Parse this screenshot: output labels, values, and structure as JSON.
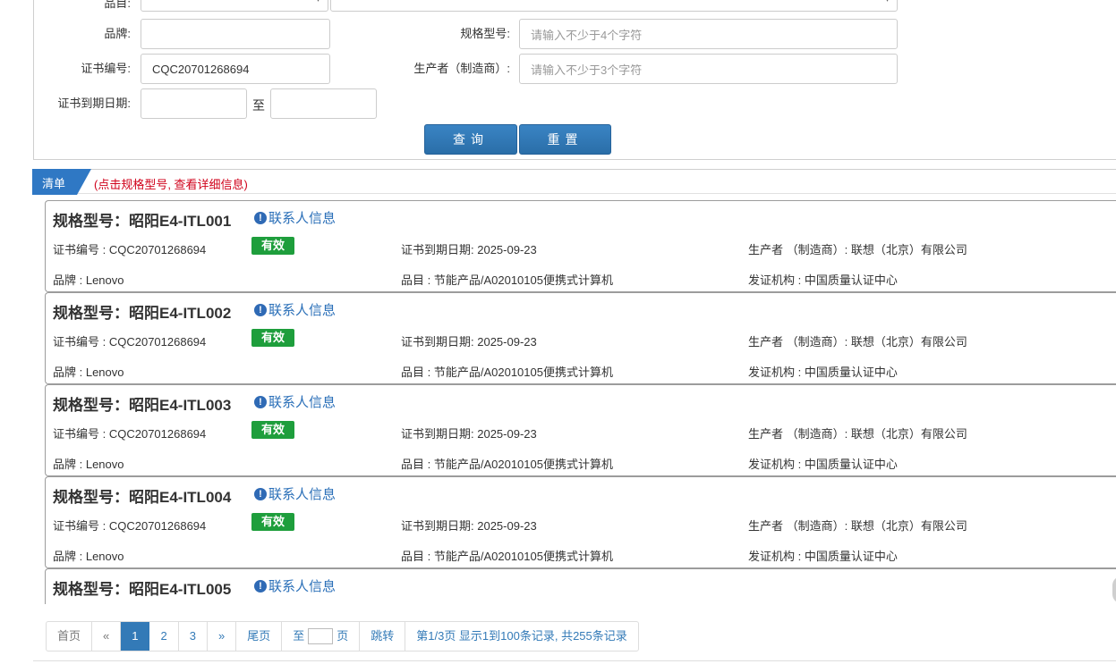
{
  "form": {
    "category_label": "品目:",
    "brand_label": "品牌:",
    "brand_value": "",
    "model_label": "规格型号:",
    "model_placeholder": "请输入不少于4个字符",
    "cert_no_label": "证书编号:",
    "cert_no_value": "CQC20701268694",
    "producer_label": "生产者（制造商）:",
    "producer_placeholder": "请输入不少于3个字符",
    "expiry_label": "证书到期日期:",
    "expiry_to": "至",
    "query_button": "查询",
    "reset_button": "重置"
  },
  "list": {
    "tab_label": "清单",
    "hint": "(点击规格型号, 查看详细信息)",
    "contact_label": "联系人信息",
    "cert_no_prefix": "证书编号 : ",
    "expiry_prefix": "证书到期日期: ",
    "producer_prefix": "生产者 （制造商）: ",
    "brand_prefix": "品牌 : ",
    "category_prefix": "品目 : ",
    "issuer_prefix": "发证机构 : ",
    "items": [
      {
        "title": "规格型号：昭阳E4-ITL001",
        "cert_no": "CQC20701268694",
        "status": "有效",
        "expiry": "2025-09-23",
        "producer": "联想（北京）有限公司",
        "brand": "Lenovo",
        "category": "节能产品/A02010105便携式计算机",
        "issuer": "中国质量认证中心"
      },
      {
        "title": "规格型号：昭阳E4-ITL002",
        "cert_no": "CQC20701268694",
        "status": "有效",
        "expiry": "2025-09-23",
        "producer": "联想（北京）有限公司",
        "brand": "Lenovo",
        "category": "节能产品/A02010105便携式计算机",
        "issuer": "中国质量认证中心"
      },
      {
        "title": "规格型号：昭阳E4-ITL003",
        "cert_no": "CQC20701268694",
        "status": "有效",
        "expiry": "2025-09-23",
        "producer": "联想（北京）有限公司",
        "brand": "Lenovo",
        "category": "节能产品/A02010105便携式计算机",
        "issuer": "中国质量认证中心"
      },
      {
        "title": "规格型号：昭阳E4-ITL004",
        "cert_no": "CQC20701268694",
        "status": "有效",
        "expiry": "2025-09-23",
        "producer": "联想（北京）有限公司",
        "brand": "Lenovo",
        "category": "节能产品/A02010105便携式计算机",
        "issuer": "中国质量认证中心"
      },
      {
        "title": "规格型号：昭阳E4-ITL005"
      }
    ]
  },
  "pagination": {
    "first": "首页",
    "prev": "«",
    "pages": [
      "1",
      "2",
      "3"
    ],
    "next": "»",
    "last": "尾页",
    "goto_prefix": "至",
    "goto_suffix": "页",
    "jump": "跳转",
    "summary": "第1/3页  显示1到100条记录, 共255条记录"
  },
  "colors": {
    "button_blue": "#2a6ea8",
    "valid_badge": "#1e9e3c",
    "hint_red": "#d0021b",
    "link_blue": "#2a6fb8"
  }
}
